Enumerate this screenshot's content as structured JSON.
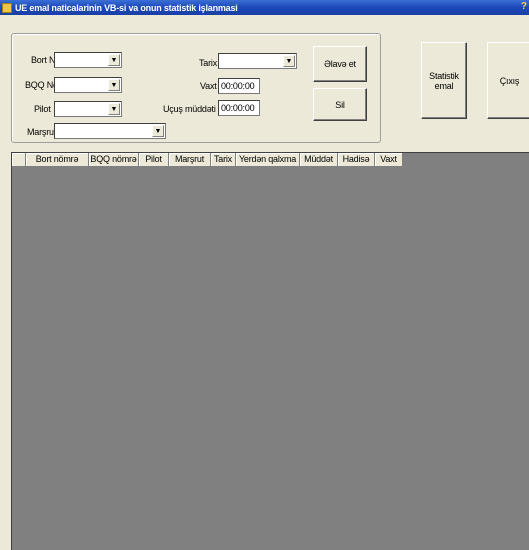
{
  "window": {
    "title": "UE emal naticalarinin VB-si va onun statistik işlanmasi",
    "help_glyph": "?"
  },
  "form": {
    "bort_no_label": "Bort No",
    "bqq_no_label": "BQQ No",
    "pilot_label": "Pilot",
    "marsrut_label": "Marşrut",
    "tarix_label": "Tarix",
    "vaxt_label": "Vaxt",
    "vaxt_value": "00:00:00",
    "ucus_label": "Uçuş müddəti",
    "ucus_value": "00:00:00",
    "bort_no_value": "",
    "bqq_no_value": "",
    "pilot_value": "",
    "marsrut_value": "",
    "tarix_value": ""
  },
  "buttons": {
    "add": "Əlavə et",
    "delete": "Sil",
    "stats_line1": "Statistik",
    "stats_line2": "emal",
    "exit": "Çıxış"
  },
  "grid": {
    "columns": [
      "Bort nömrə",
      "BQQ nömrə",
      "Pilot",
      "Marşrut",
      "Tarix",
      "Yerdən qalxma",
      "Müddət",
      "Hadisə",
      "Vaxt"
    ]
  },
  "icons": {
    "dropdown": "▼"
  }
}
